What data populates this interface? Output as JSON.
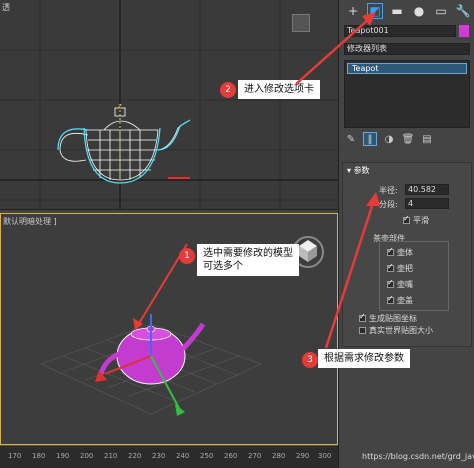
{
  "viewport_top": {
    "label": "透"
  },
  "viewport_bottom": {
    "label": "默认明暗处理 ]"
  },
  "ruler": {
    "ticks": [
      "170",
      "180",
      "190",
      "200",
      "210",
      "220",
      "230",
      "240",
      "250",
      "260",
      "270",
      "280",
      "290",
      "300"
    ]
  },
  "panel": {
    "tabs": [
      {
        "icon": "plus-icon",
        "glyph": "+"
      },
      {
        "icon": "modify-icon",
        "glyph": "◩"
      },
      {
        "icon": "hierarchy-icon",
        "glyph": "▬"
      },
      {
        "icon": "motion-icon",
        "glyph": "●"
      },
      {
        "icon": "display-icon",
        "glyph": "▭"
      },
      {
        "icon": "utilities-icon",
        "glyph": "🔧"
      }
    ],
    "object_name": "Teapot001",
    "object_color": "#d43ad6",
    "modifier_list": "修改器列表",
    "stack_item": "Teapot",
    "params": {
      "title": "参数",
      "radius_label": "半径:",
      "radius_value": "40.582",
      "segments_label": "分段:",
      "segments_value": "4",
      "smooth_label": "平滑",
      "parts_label": "茶壶部件",
      "parts": [
        "壶体",
        "壶把",
        "壶嘴",
        "壶盖"
      ],
      "gen_map": "生成贴图坐标",
      "real_world": "真实世界贴图大小"
    }
  },
  "callouts": {
    "c1_num": "1",
    "c1_text": "选中需要修改的模型\n可选多个",
    "c2_num": "2",
    "c2_text": "进入修改选项卡",
    "c3_num": "3",
    "c3_text": "根据需求修改参数",
    "accent": "#e53b3b"
  },
  "watermark": "https://blog.csdn.net/grd_java"
}
